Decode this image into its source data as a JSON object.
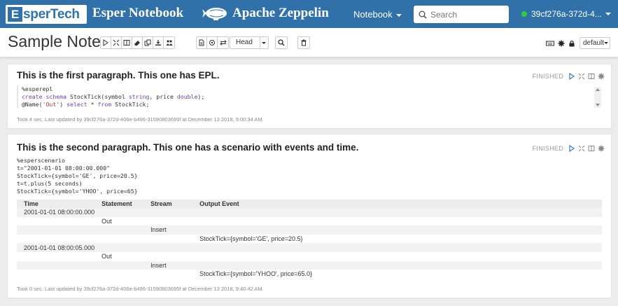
{
  "navbar": {
    "esper_logo_letter": "E",
    "esper_logo_text": "sperTech",
    "app_title": "Esper Notebook",
    "zeppelin_title": "Apache Zeppelin",
    "notebook_menu": "Notebook",
    "search_placeholder": "Search",
    "user": "39cf276a-372d-4...",
    "accent_color": "#3071a9",
    "status_color": "#2ecc40"
  },
  "note": {
    "title": "Sample Note",
    "head_label": "Head",
    "interpreter_binding": "default"
  },
  "paragraphs": [
    {
      "title": "This is the first paragraph. This one has EPL.",
      "status": "FINISHED",
      "code": [
        "%esperepl",
        "create schema StockTick(symbol string, price double);",
        "@Name('Out') select * from StockTick;"
      ],
      "footer": "Took 4 sec. Last updated by 39cf276a-372d-406e-b496-31590803695f at December 13 2018, 9:00:34 AM."
    },
    {
      "title": "This is the second paragraph. This one has a scenario with events and time.",
      "status": "FINISHED",
      "code": [
        "%esperscenario",
        "t=\"2001-01-01 08:00:00.000\"",
        "StockTick={symbol='GE', price=20.5}",
        "t=t.plus(5 seconds)",
        "StockTick={symbol='YHOO', price=65}"
      ],
      "table": {
        "headers": [
          "Time",
          "Statement",
          "Stream",
          "Output Event"
        ],
        "rows": [
          [
            "2001-01-01 08:00:00.000",
            "",
            "",
            ""
          ],
          [
            "",
            "Out",
            "",
            ""
          ],
          [
            "",
            "",
            "Insert",
            ""
          ],
          [
            "",
            "",
            "",
            "StockTick={symbol='GE', price=20.5}"
          ],
          [
            "2001-01-01 08:00:05.000",
            "",
            "",
            ""
          ],
          [
            "",
            "Out",
            "",
            ""
          ],
          [
            "",
            "",
            "Insert",
            ""
          ],
          [
            "",
            "",
            "",
            "StockTick={symbol='YHOO', price=65.0}"
          ]
        ]
      },
      "footer": "Took 0 sec. Last updated by 39cf276a-372d-406e-b496-31590803695f at December 13 2018, 9:40:42 AM."
    }
  ]
}
